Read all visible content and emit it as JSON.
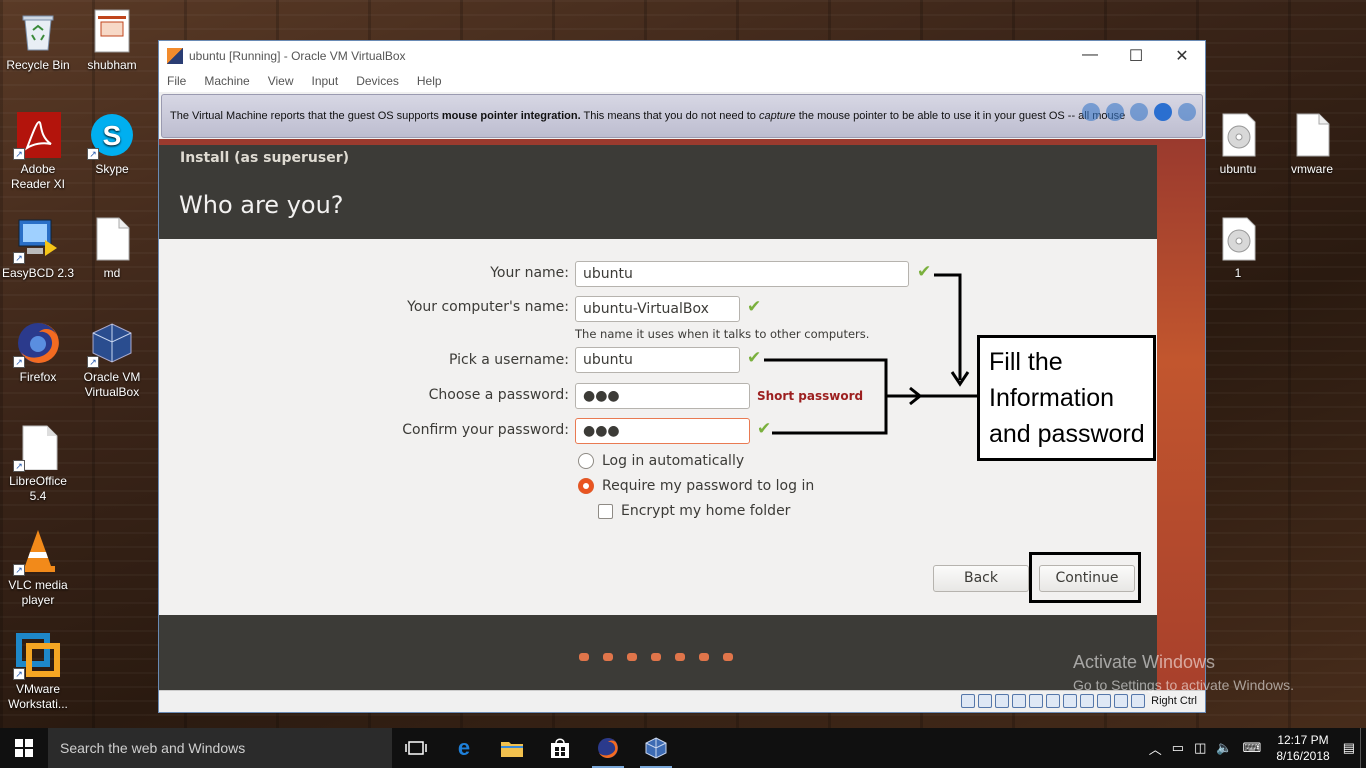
{
  "desktop": {
    "icons_left": [
      {
        "label": "Recycle Bin",
        "icon": "recycle-bin-icon"
      },
      {
        "label": "shubham",
        "icon": "presentation-file-icon"
      },
      {
        "label": "Adobe Reader XI",
        "icon": "adobe-reader-icon"
      },
      {
        "label": "Skype",
        "icon": "skype-icon"
      },
      {
        "label": "EasyBCD 2.3",
        "icon": "easybcd-icon"
      },
      {
        "label": "md",
        "icon": "document-icon"
      },
      {
        "label": "Firefox",
        "icon": "firefox-icon"
      },
      {
        "label": "Oracle VM VirtualBox",
        "icon": "virtualbox-icon"
      },
      {
        "label": "LibreOffice 5.4",
        "icon": "libreoffice-icon"
      },
      {
        "label": "VLC media player",
        "icon": "vlc-icon"
      },
      {
        "label": "VMware Workstati...",
        "icon": "vmware-icon"
      }
    ],
    "icons_right": [
      {
        "label": "ubuntu",
        "icon": "disc-image-icon"
      },
      {
        "label": "vmware",
        "icon": "document-icon"
      },
      {
        "label": "1",
        "icon": "disc-image-icon"
      }
    ]
  },
  "vbox": {
    "title": "ubuntu [Running] - Oracle VM VirtualBox",
    "menu": [
      "File",
      "Machine",
      "View",
      "Input",
      "Devices",
      "Help"
    ],
    "notice_pre": "The Virtual Machine reports that the guest OS supports ",
    "notice_bold": "mouse pointer integration.",
    "notice_mid": " This means that you do not need to ",
    "notice_italic": "capture",
    "notice_post": " the mouse pointer to be able to use it in your guest OS -- all mouse",
    "host_key": "Right Ctrl"
  },
  "installer": {
    "superuser": "Install (as superuser)",
    "heading": "Who are you?",
    "name_label": "Your name:",
    "name_value": "ubuntu",
    "computer_label": "Your computer's name:",
    "computer_value": "ubuntu-VirtualBox",
    "computer_hint": "The name it uses when it talks to other computers.",
    "username_label": "Pick a username:",
    "username_value": "ubuntu",
    "password_label": "Choose a password:",
    "password_value": "●●●",
    "password_strength": "Short password",
    "confirm_label": "Confirm your password:",
    "confirm_value": "●●●",
    "opt_auto": "Log in automatically",
    "opt_require": "Require my password to log in",
    "opt_encrypt": "Encrypt my home folder",
    "back": "Back",
    "continue": "Continue",
    "check": "✔"
  },
  "annotation": {
    "line1": "Fill the",
    "line2": "Information",
    "line3": "and password"
  },
  "watermark": {
    "line1": "Activate Windows",
    "line2": "Go to Settings to activate Windows."
  },
  "taskbar": {
    "search_placeholder": "Search the web and Windows",
    "time": "12:17 PM",
    "date": "8/16/2018"
  },
  "colors": {
    "ubuntu_orange": "#e95420",
    "installer_header": "#3c3b37",
    "check_green": "#7ab03d"
  }
}
